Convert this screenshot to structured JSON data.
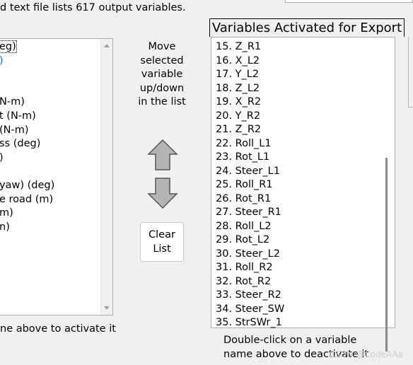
{
  "top_text": "d text file lists 617 output variables.",
  "left_list": {
    "items": [
      {
        "label": "eg)",
        "selected": true
      },
      {
        "label": ")",
        "blue": true
      },
      {
        "label": ""
      },
      {
        "label": ""
      },
      {
        "label": "N-m)"
      },
      {
        "label": "t (N-m)"
      },
      {
        "label": "(N-m)"
      },
      {
        "label": "ss (deg)"
      },
      {
        "label": ")"
      },
      {
        "label": ""
      },
      {
        "label": "yaw) (deg)"
      },
      {
        "label": "e road (m)"
      },
      {
        "label": "m)"
      },
      {
        "label": "n)"
      }
    ]
  },
  "left_hint": "ne above to activate it",
  "move_text": [
    "Move",
    "selected",
    "variable",
    "up/down",
    "in the list"
  ],
  "clear_button": [
    "Clear",
    "List"
  ],
  "right_panel": {
    "title": "Variables Activated for Export",
    "items": [
      "15. Z_R1",
      "16. X_L2",
      "17. Y_L2",
      "18. Z_L2",
      "19. X_R2",
      "20. Y_R2",
      "21. Z_R2",
      "22. Roll_L1",
      "23. Rot_L1",
      "24. Steer_L1",
      "25. Roll_R1",
      "26. Rot_R1",
      "27. Steer_R1",
      "28. Roll_L2",
      "29. Rot_L2",
      "30. Steer_L2",
      "31. Roll_R2",
      "32. Rot_R2",
      "33. Steer_R2",
      "34. Steer_SW",
      "35. StrSWr_1"
    ],
    "hint": [
      "Double-click on a variable",
      "name above to deactivate it"
    ]
  },
  "watermark": "CSDN @CodeAAa"
}
